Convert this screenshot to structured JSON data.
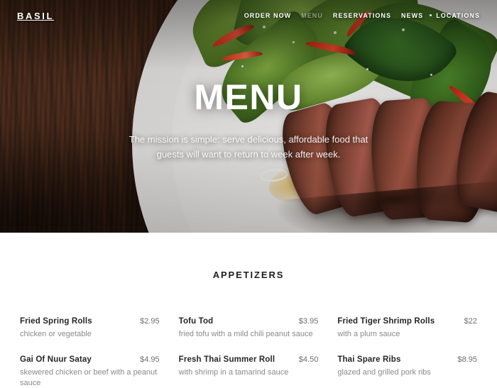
{
  "header": {
    "logo": "BASIL",
    "nav": [
      {
        "label": "ORDER NOW",
        "active": false
      },
      {
        "label": "MENU",
        "active": true
      },
      {
        "label": "RESERVATIONS",
        "active": false
      },
      {
        "label": "NEWS",
        "active": false
      },
      {
        "label": "LOCATIONS",
        "active": false
      }
    ]
  },
  "hero": {
    "title": "MENU",
    "subtitle": "The mission is simple: serve delicious, affordable food that guests will want to return to week after week.",
    "image_description": "Sliced grilled steak with fresh green salad, basil leaves and red chilies on a large white plate set on a dark wooden table"
  },
  "menu": {
    "section_title": "APPETIZERS",
    "items": [
      {
        "name": "Fried Spring Rolls",
        "price": "$2.95",
        "desc": "chicken or vegetable"
      },
      {
        "name": "Tofu Tod",
        "price": "$3.95",
        "desc": "fried tofu with a mild chili peanut sauce"
      },
      {
        "name": "Fried Tiger Shrimp Rolls",
        "price": "$22",
        "desc": "with a plum sauce"
      },
      {
        "name": "Gai Of Nuur Satay",
        "price": "$4.95",
        "desc": "skewered chicken or beef with a peanut sauce"
      },
      {
        "name": "Fresh Thai Summer Roll",
        "price": "$4.50",
        "desc": "with shrimp in a tamarind sauce"
      },
      {
        "name": "Thai Spare Ribs",
        "price": "$8.95",
        "desc": "glazed and grilled pork ribs"
      }
    ]
  },
  "colors": {
    "hero_wood": "#3b2214",
    "plate_white": "#eceae7",
    "text_dark": "#262626",
    "text_muted": "#8a8a8a",
    "page_background": "#ffffff"
  }
}
